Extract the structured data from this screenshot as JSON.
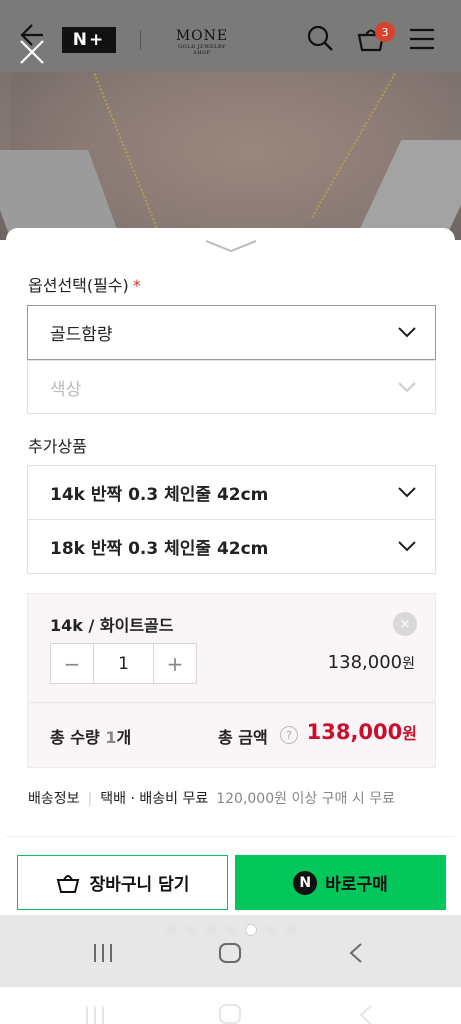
{
  "header": {
    "nplus_label": "N+",
    "brand_name": "MONE",
    "brand_sub": "GOLD JEWELRY SHOP",
    "cart_count": "3"
  },
  "options": {
    "section_label": "옵션선택(필수)",
    "required_mark": "*",
    "select1": "골드함량",
    "select2": "색상"
  },
  "addons": {
    "section_label": "추가상품",
    "items": [
      "14k 반짝 0.3 체인줄 42cm",
      "18k 반짝 0.3 체인줄 42cm"
    ]
  },
  "selected": {
    "title": "14k / 화이트골드",
    "remove": "×",
    "minus": "−",
    "quantity": "1",
    "plus": "+",
    "price": "138,000",
    "price_unit": "원"
  },
  "totals": {
    "qty_label": "총 수량",
    "qty_value": "1",
    "qty_unit": "개",
    "amount_label": "총 금액",
    "help": "?",
    "amount": "138,000",
    "amount_unit": "원"
  },
  "shipping": {
    "label": "배송정보",
    "method": "택배 · 배송비 무료",
    "condition": "120,000원 이상 구매 시 무료"
  },
  "actions": {
    "cart_label": "장바구니 담기",
    "buy_label": "바로구매",
    "npay_label": "N",
    "brand_color": "#03c75a",
    "price_color": "#c8102e"
  },
  "carousel": {
    "total": 7,
    "active": 5
  }
}
